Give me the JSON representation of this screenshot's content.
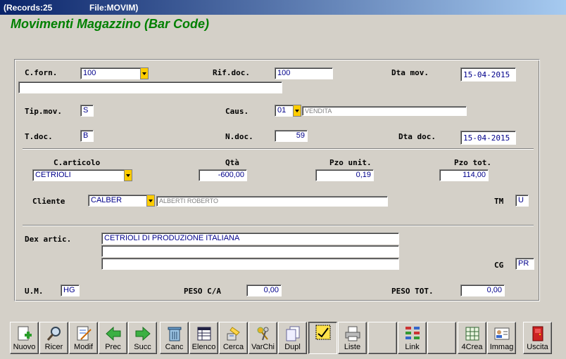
{
  "titlebar": {
    "records": "(Records:25",
    "file": "File:MOVIM)"
  },
  "app_title": "Movimenti Magazzino (Bar Code)",
  "form": {
    "c_forn_label": "C.forn.",
    "c_forn_value": "100",
    "supplier_name": "",
    "rif_doc_label": "Rif.doc.",
    "rif_doc_value": "100",
    "dta_mov_label": "Dta mov.",
    "dta_mov_value": "15-04-2015",
    "tip_mov_label": "Tip.mov.",
    "tip_mov_value": "S",
    "caus_label": "Caus.",
    "caus_code": "01",
    "caus_desc": "VENDITA",
    "t_doc_label": "T.doc.",
    "t_doc_value": "B",
    "n_doc_label": "N.doc.",
    "n_doc_value": "59",
    "dta_doc_label": "Dta doc.",
    "dta_doc_value": "15-04-2015",
    "c_articolo_label": "C.articolo",
    "c_articolo_value": "CETRIOLI",
    "qta_label": "Qtà",
    "qta_value": "-600,00",
    "pzo_unit_label": "Pzo unit.",
    "pzo_unit_value": "0,19",
    "pzo_tot_label": "Pzo tot.",
    "pzo_tot_value": "114,00",
    "cliente_label": "Cliente",
    "cliente_code": "CALBER",
    "cliente_name": "ALBERTI ROBERTO",
    "tm_label": "TM",
    "tm_value": "U",
    "dex_artic_label": "Dex artic.",
    "dex_line1": "CETRIOLI DI PRODUZIONE ITALIANA",
    "dex_line2": "",
    "dex_line3": "",
    "cg_label": "CG",
    "cg_value": "PR",
    "um_label": "U.M.",
    "um_value": "HG",
    "peso_ca_label": "PESO C/A",
    "peso_ca_value": "0,00",
    "peso_tot_label": "PESO TOT.",
    "peso_tot_value": "0,00"
  },
  "toolbar": {
    "nuovo": "Nuovo",
    "ricer": "Ricer",
    "modif": "Modif",
    "prec": "Prec",
    "succ": "Succ",
    "canc": "Canc",
    "elenco": "Elenco",
    "cerca": "Cerca",
    "varchi": "VarChi",
    "dupl": "Dupl",
    "liste": "Liste",
    "link": "Link",
    "crea4": "4Crea",
    "immag": "Immag",
    "uscita": "Uscita"
  },
  "colors": {
    "title_green": "#008000",
    "field_text": "#00008b",
    "dropdown_yellow": "#ffcc00",
    "background": "#d4d0c8"
  }
}
